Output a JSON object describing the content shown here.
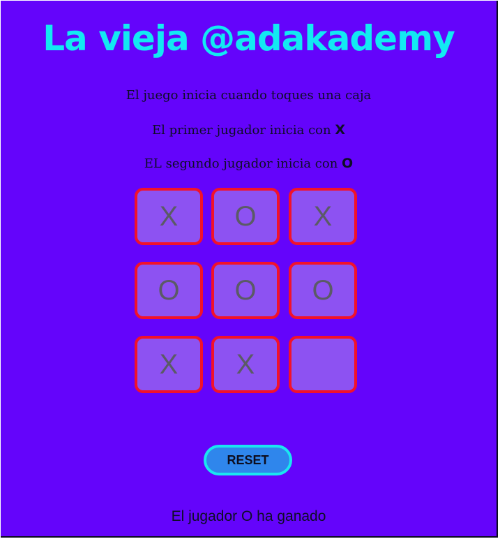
{
  "title": "La vieja @adakademy",
  "instructions": {
    "line1": "El juego inicia cuando toques una caja",
    "line2_text": "El primer jugador inicia con",
    "line2_symbol": "X",
    "line3_text": "EL segundo jugador inicia con",
    "line3_symbol": "O"
  },
  "board": {
    "cells": [
      "X",
      "O",
      "X",
      "O",
      "O",
      "O",
      "X",
      "X",
      ""
    ]
  },
  "reset_label": "RESET",
  "status": "El jugador O ha ganado",
  "colors": {
    "background": "#6404fb",
    "title": "#12eaf2",
    "cell_fill": "#8d52f2",
    "cell_border": "#f2122a",
    "reset_fill": "#2f86ec",
    "reset_border": "#1ae6f0"
  }
}
